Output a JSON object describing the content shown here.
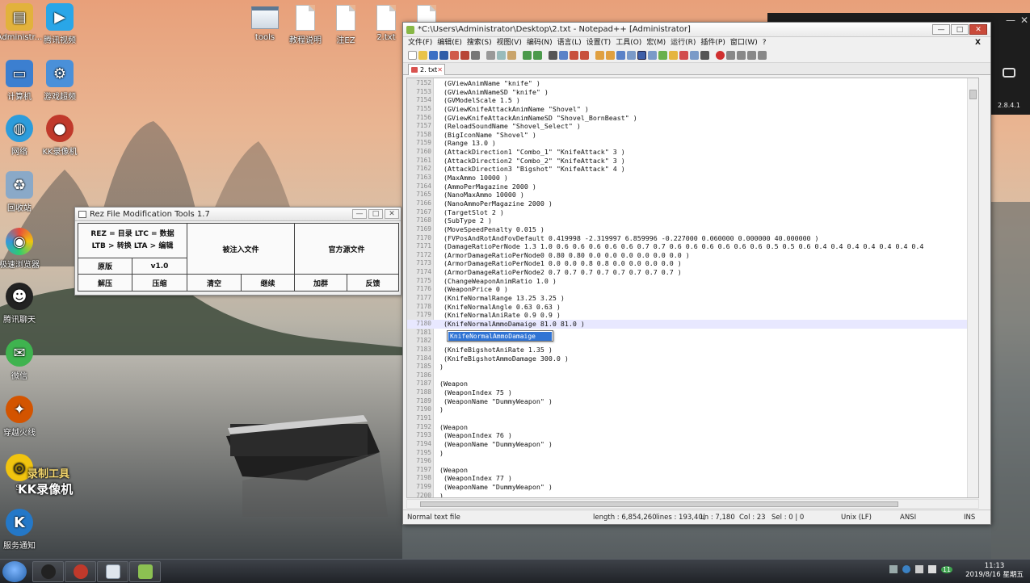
{
  "desktop": {
    "icons": [
      {
        "label": "Administr...",
        "icon": "user-folder-icon",
        "color": "#e2b23c"
      },
      {
        "label": "腾讯视频",
        "icon": "video-player-icon",
        "color": "#29a6e8"
      },
      {
        "label": "计算机",
        "icon": "computer-icon",
        "color": "#3c7fd0"
      },
      {
        "label": "游戏超频",
        "icon": "game-boost-icon",
        "color": "#4a90d9"
      },
      {
        "label": "网络",
        "icon": "network-icon",
        "color": "#2d9cdb"
      },
      {
        "label": "KK录像机",
        "icon": "kk-recorder-icon",
        "color": "#c0392b"
      },
      {
        "label": "回收站",
        "icon": "recycle-bin-icon",
        "color": "#8aa9c8"
      },
      {
        "label": "极速浏览器",
        "icon": "browser-icon",
        "color": "#e74c3c"
      },
      {
        "label": "腾讯聊天",
        "icon": "qq-icon",
        "color": "#222222"
      },
      {
        "label": "微信",
        "icon": "wechat-icon",
        "color": "#3fb34f"
      },
      {
        "label": "穿越火线",
        "icon": "crossfire-icon",
        "color": "#d35400"
      },
      {
        "label": "Si",
        "icon": "recording-tool-icon",
        "color": "#f1c40f"
      },
      {
        "label": "服务通知",
        "icon": "k-app-icon",
        "color": "#2478c8"
      }
    ],
    "files": [
      {
        "label": "tools",
        "type": "folder"
      },
      {
        "label": "教程说明",
        "type": "file"
      },
      {
        "label": "注EZ",
        "type": "file"
      },
      {
        "label": "2.txt",
        "type": "file"
      },
      {
        "label": "",
        "type": "file"
      }
    ],
    "watermark_line1": "录制工具",
    "watermark_line2": "KK录像机"
  },
  "rez_window": {
    "title": "Rez File Modification Tools 1.7",
    "legend_line1": "REZ = 目录  LTC = 数据",
    "legend_line2": "LTB > 转换  LTA > 编辑",
    "inject_label": "被注入文件",
    "source_label": "官方源文件",
    "original_label": "原版",
    "version_label": "v1.0",
    "buttons": [
      "解压",
      "压缩",
      "清空",
      "继续",
      "加群",
      "反馈"
    ]
  },
  "npp": {
    "title": "*C:\\Users\\Administrator\\Desktop\\2.txt - Notepad++ [Administrator]",
    "menu": [
      "文件(F)",
      "编辑(E)",
      "搜索(S)",
      "视图(V)",
      "编码(N)",
      "语言(L)",
      "设置(T)",
      "工具(O)",
      "宏(M)",
      "运行(R)",
      "插件(P)",
      "窗口(W)",
      "?"
    ],
    "menu_close": "X",
    "tab_label": "2. txt",
    "autocomplete": "KnifeNormalAmmoDamaige",
    "lines": [
      {
        "n": "7152",
        "t": " (GViewAnimName \"knife\" )"
      },
      {
        "n": "7153",
        "t": " (GViewAnimNameSD \"knife\" )"
      },
      {
        "n": "7154",
        "t": " (GVModelScale 1.5 )"
      },
      {
        "n": "7155",
        "t": " (GViewKnifeAttackAnimName \"Shovel\" )"
      },
      {
        "n": "7156",
        "t": " (GViewKnifeAttackAnimNameSD \"Shovel_BornBeast\" )"
      },
      {
        "n": "7157",
        "t": " (ReloadSoundName \"Shovel_Select\" )"
      },
      {
        "n": "7158",
        "t": " (BigIconName \"Shovel\" )"
      },
      {
        "n": "7159",
        "t": " (Range 13.0 )"
      },
      {
        "n": "7160",
        "t": " (AttackDirection1 \"Combo_1\" \"KnifeAttack\" 3 )"
      },
      {
        "n": "7161",
        "t": " (AttackDirection2 \"Combo_2\" \"KnifeAttack\" 3 )"
      },
      {
        "n": "7162",
        "t": " (AttackDirection3 \"Bigshot\" \"KnifeAttack\" 4 )"
      },
      {
        "n": "7163",
        "t": " (MaxAmmo 10000 )"
      },
      {
        "n": "7164",
        "t": " (AmmoPerMagazine 2000 )"
      },
      {
        "n": "7165",
        "t": " (NanoMaxAmmo 10000 )"
      },
      {
        "n": "7166",
        "t": " (NanoAmmoPerMagazine 2000 )"
      },
      {
        "n": "7167",
        "t": " (TargetSlot 2 )"
      },
      {
        "n": "7168",
        "t": " (SubType 2 )"
      },
      {
        "n": "7169",
        "t": " (MoveSpeedPenalty 0.015 )"
      },
      {
        "n": "7170",
        "t": " (FVPosAndRotAndFovDefault 0.419998 -2.319997 6.859996 -0.227000 0.060000 0.000000 40.000000 )"
      },
      {
        "n": "7171",
        "t": " (DamageRatioPerNode 1.3 1.0 0.6 0.6 0.6 0.6 0.6 0.7 0.7 0.6 0.6 0.6 0.6 0.6 0.6 0.5 0.5 0.6 0.4 0.4 0.4 0.4 0.4 0.4 0.4"
      },
      {
        "n": "7172",
        "t": " (ArmorDamageRatioPerNode0 0.80 0.80 0.0 0.0 0.0 0.0 0.0 0.0 )"
      },
      {
        "n": "7173",
        "t": " (ArmorDamageRatioPerNode1 0.0 0.0 0.8 0.8 0.0 0.0 0.0 0.0 )"
      },
      {
        "n": "7174",
        "t": " (ArmorDamageRatioPerNode2 0.7 0.7 0.7 0.7 0.7 0.7 0.7 0.7 )"
      },
      {
        "n": "7175",
        "t": " (ChangeWeaponAnimRatio 1.0 )"
      },
      {
        "n": "7176",
        "t": " (WeaponPrice 0 )"
      },
      {
        "n": "7177",
        "t": " (KnifeNormalRange 13.25 3.25 )"
      },
      {
        "n": "7178",
        "t": " (KnifeNormalAngle 0.63 0.63 )"
      },
      {
        "n": "7179",
        "t": " (KnifeNormalAniRate 0.9 0.9 )"
      },
      {
        "n": "7180",
        "t": " (KnifeNormalAmmoDamaige 81.0 81.0 )"
      },
      {
        "n": "7181",
        "t": ""
      },
      {
        "n": "7182",
        "t": ""
      },
      {
        "n": "7183",
        "t": " (KnifeBigshotAniRate 1.35 )"
      },
      {
        "n": "7184",
        "t": " (KnifeBigshotAmmoDamage 300.0 )"
      },
      {
        "n": "7185",
        "t": ")"
      },
      {
        "n": "7186",
        "t": ""
      },
      {
        "n": "7187",
        "t": "(Weapon"
      },
      {
        "n": "7188",
        "t": " (WeaponIndex 75 )"
      },
      {
        "n": "7189",
        "t": " (WeaponName \"DummyWeapon\" )"
      },
      {
        "n": "7190",
        "t": ")"
      },
      {
        "n": "7191",
        "t": ""
      },
      {
        "n": "7192",
        "t": "(Weapon"
      },
      {
        "n": "7193",
        "t": " (WeaponIndex 76 )"
      },
      {
        "n": "7194",
        "t": " (WeaponName \"DummyWeapon\" )"
      },
      {
        "n": "7195",
        "t": ")"
      },
      {
        "n": "7196",
        "t": ""
      },
      {
        "n": "7197",
        "t": "(Weapon"
      },
      {
        "n": "7198",
        "t": " (WeaponIndex 77 )"
      },
      {
        "n": "7199",
        "t": " (WeaponName \"DummyWeapon\" )"
      },
      {
        "n": "7200",
        "t": ")"
      }
    ],
    "status": {
      "file_type": "Normal text file",
      "length": "length : 6,854,260",
      "lines": "lines : 193,40(",
      "ln": "Ln : 7,180",
      "col": "Col : 23",
      "sel": "Sel : 0 | 0",
      "eol": "Unix (LF)",
      "encoding": "ANSI",
      "mode": "INS"
    }
  },
  "side_window": {
    "version": "2.8.4.1"
  },
  "taskbar": {
    "time": "11:13",
    "date": "2019/8/16 星期五",
    "tray_badge": "11"
  }
}
